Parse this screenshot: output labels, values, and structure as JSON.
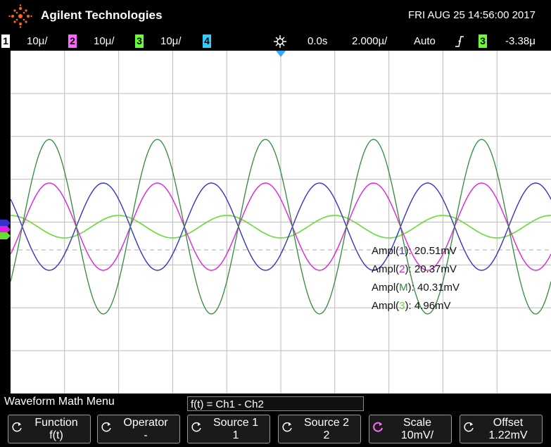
{
  "header": {
    "brand": "Agilent Technologies",
    "datetime": "FRI AUG 25 14:56:00 2017"
  },
  "channel_bar": {
    "ch1": {
      "num": "1",
      "scale": "10μ/",
      "color": "#ffffff"
    },
    "ch2": {
      "num": "2",
      "scale": "10μ/",
      "color": "#ff66ff"
    },
    "ch3": {
      "num": "3",
      "scale": "10μ/",
      "color": "#66ff33"
    },
    "ch4": {
      "num": "4",
      "scale": "",
      "color": "#33ccff"
    },
    "delay": "0.0s",
    "timebase": "2.000µ/",
    "trigger_mode": "Auto",
    "trigger_source": "3",
    "trigger_level": "-3.38μ"
  },
  "colors": {
    "ch1": "#3333cc",
    "ch2": "#e020e0",
    "ch3": "#66dd33",
    "math": "#2e8b3a",
    "grid": "#9a9a9a"
  },
  "measurements": [
    {
      "label": "Ampl(",
      "ch": "1",
      "value": "): 20.51mV"
    },
    {
      "label": "Ampl(",
      "ch": "2",
      "value": "): 20.37mV"
    },
    {
      "label": "Ampl(",
      "ch": "M",
      "value": "): 40.31mV"
    },
    {
      "label": "Ampl(",
      "ch": "3",
      "value": "): 4.96mV"
    }
  ],
  "menu": {
    "title": "Waveform Math Menu",
    "formula": "f(t) = Ch1 - Ch2",
    "softkeys": [
      {
        "label": "Function",
        "value": "f(t)"
      },
      {
        "label": "Operator",
        "value": "-"
      },
      {
        "label": "Source 1",
        "value": "1"
      },
      {
        "label": "Source 2",
        "value": "2"
      },
      {
        "label": "Scale",
        "value": "10mV/"
      },
      {
        "label": "Offset",
        "value": "1.22mV"
      }
    ]
  }
}
